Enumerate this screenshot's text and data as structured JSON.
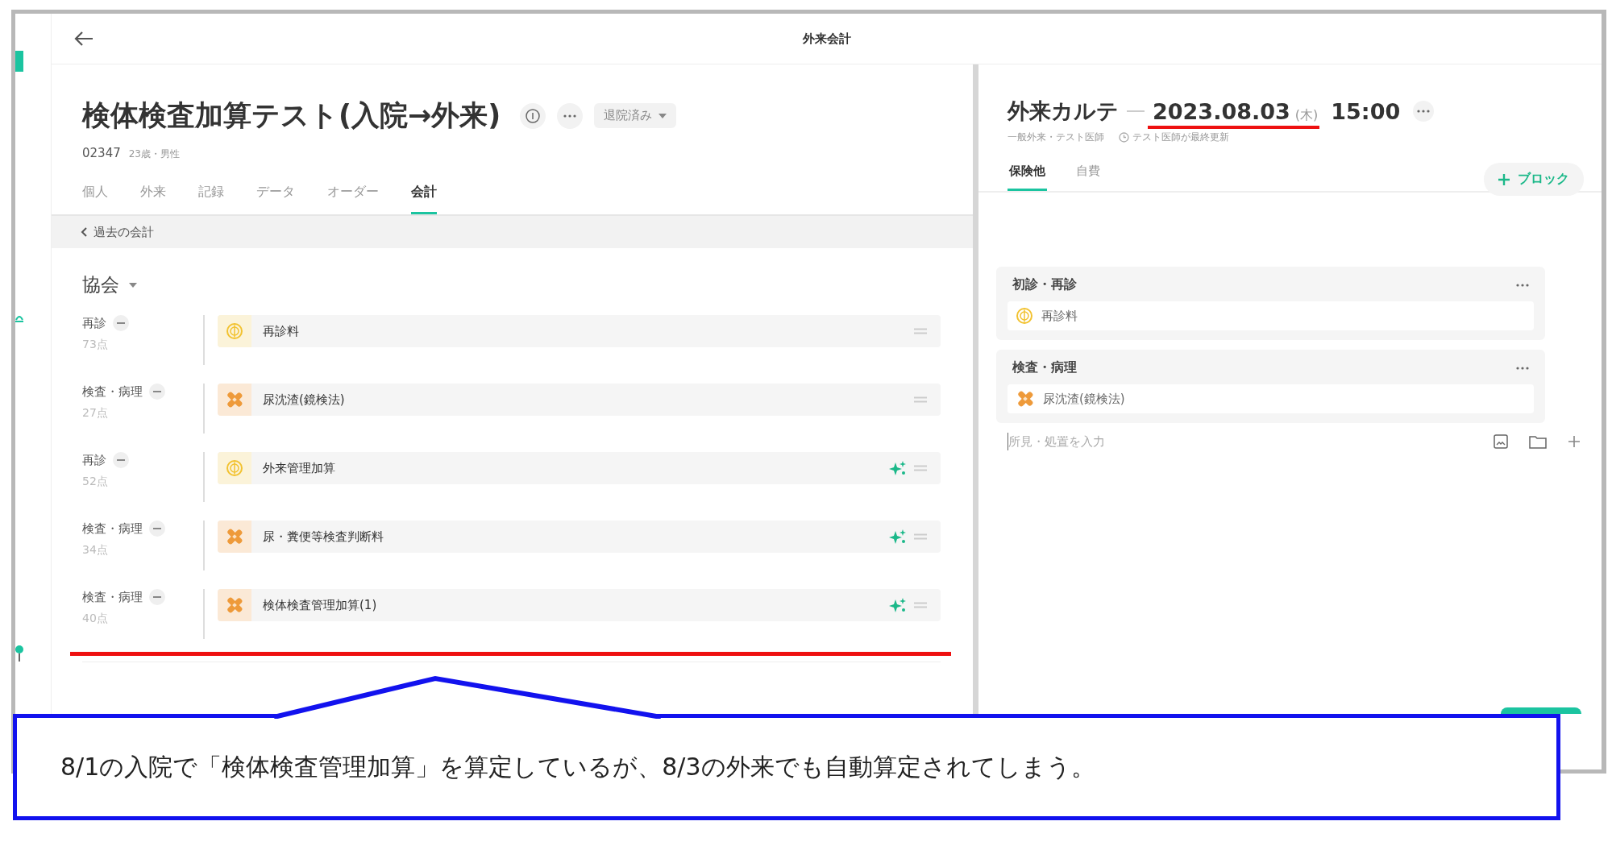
{
  "header": {
    "title": "外来会計"
  },
  "patient": {
    "name": "検体検査加算テスト(入院→外来)",
    "id": "02347",
    "info": "23歳・男性",
    "status": "退院済み"
  },
  "tabs": [
    {
      "label": "個人",
      "selected": false
    },
    {
      "label": "外来",
      "selected": false
    },
    {
      "label": "記録",
      "selected": false
    },
    {
      "label": "データ",
      "selected": false
    },
    {
      "label": "オーダー",
      "selected": false
    },
    {
      "label": "会計",
      "selected": true
    }
  ],
  "past_link": "過去の会計",
  "group": {
    "title": "協会"
  },
  "items": [
    {
      "category": "再診",
      "points": "73点",
      "name": "再診料",
      "kind": "fee",
      "auto": false
    },
    {
      "category": "検査・病理",
      "points": "27点",
      "name": "尿沈渣(鏡検法)",
      "kind": "test",
      "auto": false
    },
    {
      "category": "再診",
      "points": "52点",
      "name": "外来管理加算",
      "kind": "fee",
      "auto": true
    },
    {
      "category": "検査・病理",
      "points": "34点",
      "name": "尿・糞便等検査判断料",
      "kind": "test",
      "auto": true
    },
    {
      "category": "検査・病理",
      "points": "40点",
      "name": "検体検査管理加算(1)",
      "kind": "test",
      "auto": true
    }
  ],
  "chart": {
    "title": "外来カルテ",
    "date": "2023.08.03",
    "weekday": "(木)",
    "time": "15:00",
    "meta": "一般外来・テスト医師",
    "updated": "テスト医師が最終更新",
    "tabs": [
      {
        "label": "保険他",
        "selected": true
      },
      {
        "label": "自費",
        "selected": false
      }
    ],
    "add_block": "ブロック",
    "sections": [
      {
        "title": "初診・再診",
        "items": [
          {
            "name": "再診料",
            "kind": "fee"
          }
        ]
      },
      {
        "title": "検査・病理",
        "items": [
          {
            "name": "尿沈渣(鏡検法)",
            "kind": "test"
          }
        ]
      }
    ],
    "input": {
      "placeholder": "所見・処置を入力"
    }
  },
  "annotation": {
    "text": "8/1の入院で「検体検査管理加算」を算定しているが、8/3の外来でも自動算定されてしまう。"
  }
}
